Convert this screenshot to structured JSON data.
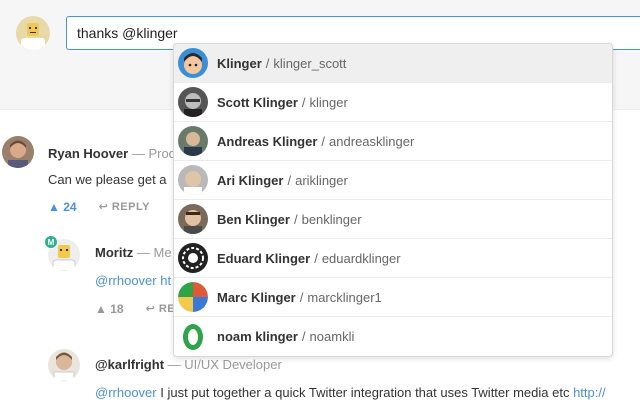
{
  "composer": {
    "input_value": "thanks @klinger"
  },
  "comments": [
    {
      "name": "Ryan Hoover",
      "role": "— Prod",
      "body": "Can we please get a",
      "votes": "▲ 24",
      "reply": "↩ REPLY"
    },
    {
      "name": "Moritz",
      "role": "— Me",
      "badge": "M",
      "body_link": "@rrhoover ht",
      "votes": "▲ 18",
      "reply": "↩ REP"
    },
    {
      "name": "@karlfright",
      "role": "— UI/UX Developer",
      "body_link": "@rrhoover",
      "body": " I just put together a quick Twitter integration that uses Twitter media etc ",
      "body_tail_link": "http://"
    }
  ],
  "mention_dropdown": {
    "items": [
      {
        "name": "Klinger",
        "separator": "/",
        "handle": "klinger_scott",
        "selected": true,
        "avatar_color": "#3a8fd6"
      },
      {
        "name": "Scott Klinger",
        "separator": "/",
        "handle": "klinger",
        "selected": false,
        "avatar_color": "#555555"
      },
      {
        "name": "Andreas Klinger",
        "separator": "/",
        "handle": "andreasklinger",
        "selected": false,
        "avatar_color": "#6a7a6a"
      },
      {
        "name": "Ari Klinger",
        "separator": "/",
        "handle": "ariklinger",
        "selected": false,
        "avatar_color": "#b9b9b9"
      },
      {
        "name": "Ben Klinger",
        "separator": "/",
        "handle": "benklinger",
        "selected": false,
        "avatar_color": "#7a6a5a"
      },
      {
        "name": "Eduard Klinger",
        "separator": "/",
        "handle": "eduardklinger",
        "selected": false,
        "avatar_color": "#222222"
      },
      {
        "name": "Marc Klinger",
        "separator": "/",
        "handle": "marcklinger1",
        "selected": false,
        "avatar_color": "#e05a3a"
      },
      {
        "name": "noam klinger",
        "separator": "/",
        "handle": "noamkli",
        "selected": false,
        "avatar_color": "#2ea34a"
      }
    ]
  },
  "colors": {
    "accent": "#4a90e2",
    "maker_badge": "#29b28e",
    "muted": "#999999"
  }
}
